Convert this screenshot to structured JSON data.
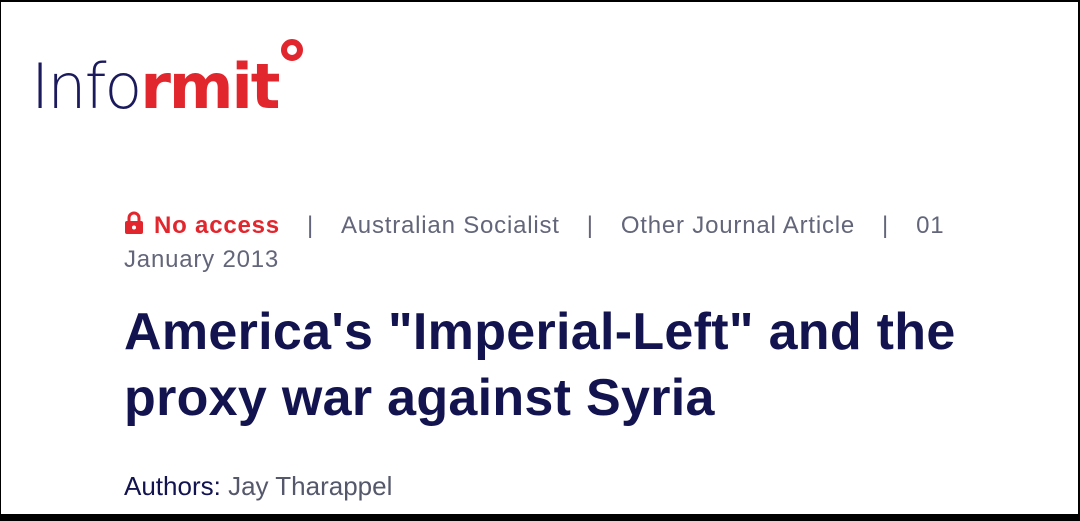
{
  "brand": {
    "part1": "Info",
    "part2": "rmit",
    "primary_color": "#1b1a5c",
    "accent_color": "#e1262d"
  },
  "meta": {
    "lock_icon": "lock-icon",
    "access": "No access",
    "separator": "|",
    "publication": "Australian Socialist",
    "type": "Other Journal Article",
    "date": "01 January 2013"
  },
  "article": {
    "title": "America's \"Imperial-Left\" and the proxy war against Syria"
  },
  "authors": {
    "label": "Authors:",
    "names": "Jay Tharappel"
  }
}
